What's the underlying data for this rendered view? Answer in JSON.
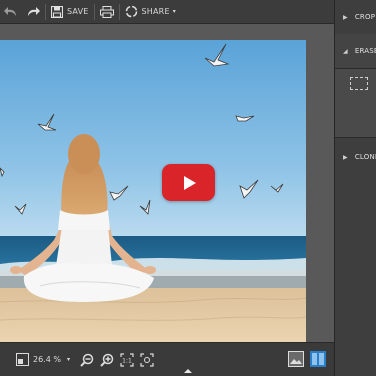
{
  "toolbar": {
    "save_label": "SAVE",
    "share_label": "SHARE"
  },
  "panel": {
    "crop_label": "CROP",
    "erase_label": "ERASE",
    "clone_label": "CLONE"
  },
  "status": {
    "zoom_label": "26.4 %"
  },
  "colors": {
    "play_button": "#d9242a",
    "toolbar_bg": "#3c3c3c",
    "panel_bg": "#3e3e3e",
    "sky": "#5ea6d8",
    "sea": "#1f5f86",
    "sand": "#e4c9a0"
  }
}
